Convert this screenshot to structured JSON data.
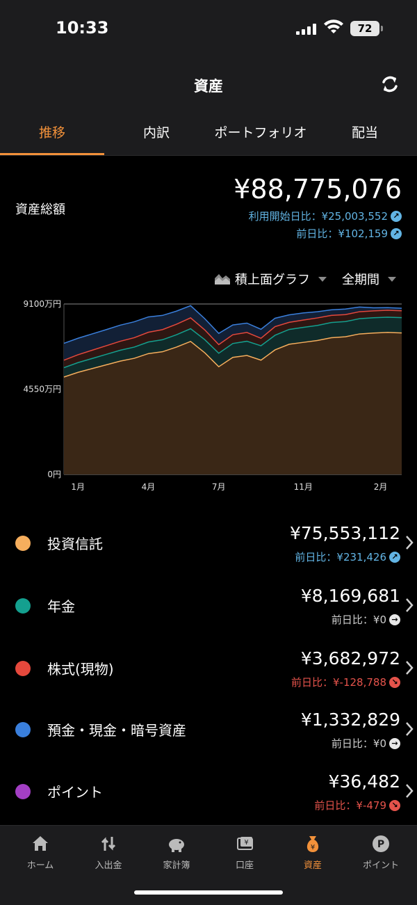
{
  "status": {
    "time": "10:33",
    "battery": "72"
  },
  "header": {
    "title": "資産"
  },
  "tabs": [
    {
      "label": "推移",
      "active": true
    },
    {
      "label": "内訳",
      "active": false
    },
    {
      "label": "ポートフォリオ",
      "active": false
    },
    {
      "label": "配当",
      "active": false
    }
  ],
  "summary": {
    "label": "資産総額",
    "amount": "¥88,775,076",
    "since_start": "利用開始日比：¥25,003,552",
    "vs_yesterday": "前日比：¥102,159"
  },
  "chart_controls": {
    "graph_type": "積上面グラフ",
    "period": "全期間"
  },
  "chart_data": {
    "type": "area",
    "stacked": true,
    "y_ticks": [
      "9100万円",
      "4550万円",
      "0円"
    ],
    "x_ticks": [
      "1月",
      "4月",
      "7月",
      "11月",
      "2月"
    ],
    "ylim": [
      0,
      9100
    ],
    "x": [
      0,
      1,
      2,
      3,
      4,
      5,
      6,
      7,
      8,
      9,
      10,
      11,
      12,
      13,
      14,
      15,
      16,
      17,
      18,
      19,
      20,
      21,
      22,
      23,
      24
    ],
    "series": [
      {
        "name": "投資信託",
        "color": "#f6ae5d",
        "values": [
          5200,
          5450,
          5650,
          5850,
          6050,
          6200,
          6450,
          6550,
          6800,
          7100,
          6500,
          5750,
          6250,
          6350,
          6100,
          6650,
          6950,
          7050,
          7150,
          7300,
          7350,
          7500,
          7550,
          7580,
          7555
        ]
      },
      {
        "name": "年金",
        "color": "#14a08f",
        "values": [
          500,
          520,
          540,
          560,
          580,
          600,
          620,
          640,
          660,
          680,
          700,
          720,
          740,
          760,
          770,
          780,
          790,
          800,
          805,
          810,
          812,
          814,
          815,
          816,
          817
        ]
      },
      {
        "name": "株式(現物)",
        "color": "#e5483c",
        "values": [
          400,
          420,
          440,
          460,
          480,
          500,
          520,
          540,
          560,
          580,
          520,
          460,
          470,
          470,
          400,
          460,
          380,
          390,
          400,
          380,
          370,
          375,
          370,
          368,
          368
        ]
      },
      {
        "name": "預金・現金・暗号資産",
        "color": "#3a7fdc",
        "values": [
          900,
          880,
          870,
          860,
          860,
          850,
          820,
          760,
          700,
          650,
          600,
          600,
          520,
          500,
          480,
          450,
          400,
          380,
          330,
          300,
          300,
          250,
          160,
          140,
          133
        ]
      }
    ]
  },
  "assets": [
    {
      "name": "投資信託",
      "color": "#f6ae5d",
      "amount": "¥75,553,112",
      "delta": "前日比：¥231,426",
      "trend": "up",
      "trend_color": "#62b4e4"
    },
    {
      "name": "年金",
      "color": "#14a08f",
      "amount": "¥8,169,681",
      "delta": "前日比：¥0",
      "trend": "flat",
      "trend_color": "#cfcfcf"
    },
    {
      "name": "株式(現物)",
      "color": "#e5483c",
      "amount": "¥3,682,972",
      "delta": "前日比：¥-128,788",
      "trend": "down",
      "trend_color": "#e5534b"
    },
    {
      "name": "預金・現金・暗号資産",
      "color": "#3a7fdc",
      "amount": "¥1,332,829",
      "delta": "前日比：¥0",
      "trend": "flat",
      "trend_color": "#cfcfcf"
    },
    {
      "name": "ポイント",
      "color": "#a33fc4",
      "amount": "¥36,482",
      "delta": "前日比：¥-479",
      "trend": "down",
      "trend_color": "#e5534b"
    }
  ],
  "bottom_nav": [
    {
      "label": "ホーム",
      "icon": "home-icon",
      "active": false
    },
    {
      "label": "入出金",
      "icon": "transfer-icon",
      "active": false
    },
    {
      "label": "家計簿",
      "icon": "piggy-bank-icon",
      "active": false
    },
    {
      "label": "口座",
      "icon": "account-icon",
      "active": false
    },
    {
      "label": "資産",
      "icon": "money-bag-icon",
      "active": true
    },
    {
      "label": "ポイント",
      "icon": "point-icon",
      "active": false
    }
  ]
}
